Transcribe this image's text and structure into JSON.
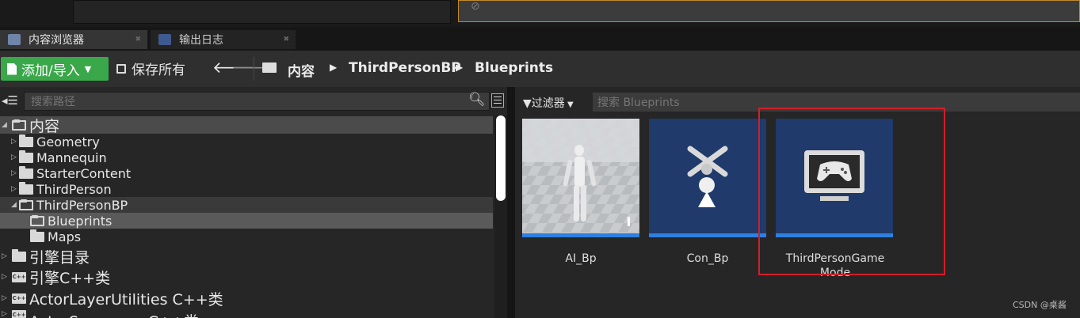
{
  "tabs": [
    {
      "label": "内容浏览器",
      "icon": "content-browser-icon",
      "active": true
    },
    {
      "label": "输出日志",
      "icon": "output-log-icon",
      "active": false
    }
  ],
  "toolbar": {
    "add_import_label": "添加/导入",
    "save_all_label": "保存所有",
    "breadcrumb": [
      "内容",
      "ThirdPersonBP",
      "Blueprints"
    ]
  },
  "sources": {
    "search_placeholder": "搜索路径",
    "tree": [
      {
        "label": "内容",
        "level": 0,
        "expanded": true
      },
      {
        "label": "Geometry",
        "level": 1
      },
      {
        "label": "Mannequin",
        "level": 1
      },
      {
        "label": "StarterContent",
        "level": 1
      },
      {
        "label": "ThirdPerson",
        "level": 1
      },
      {
        "label": "ThirdPersonBP",
        "level": 1,
        "expanded": true
      },
      {
        "label": "Blueprints",
        "level": 2,
        "selected": true
      },
      {
        "label": "Maps",
        "level": 2
      },
      {
        "label": "引擎目录",
        "level": 0
      },
      {
        "label": "引擎C++类",
        "level": 0
      },
      {
        "label": "ActorLayerUtilities C++类",
        "level": 0
      },
      {
        "label": "ActorSequence C++类",
        "level": 0
      }
    ]
  },
  "assets": {
    "filter_label": "过滤器",
    "search_placeholder": "搜索 Blueprints",
    "items": [
      {
        "name": "AI_Bp",
        "thumbnail": "mannequin-thumbnail"
      },
      {
        "name": "Con_Bp",
        "thumbnail": "controller-thumbnail"
      },
      {
        "name_line1": "ThirdPersonGame",
        "name_line2": "Mode",
        "thumbnail": "gamemode-thumbnail"
      }
    ]
  },
  "watermark": "CSDN @桌酱",
  "colors": {
    "accent_green": "#3aa74a",
    "asset_bar_blue": "#2f7fe0",
    "highlight_red": "#d0202a"
  }
}
